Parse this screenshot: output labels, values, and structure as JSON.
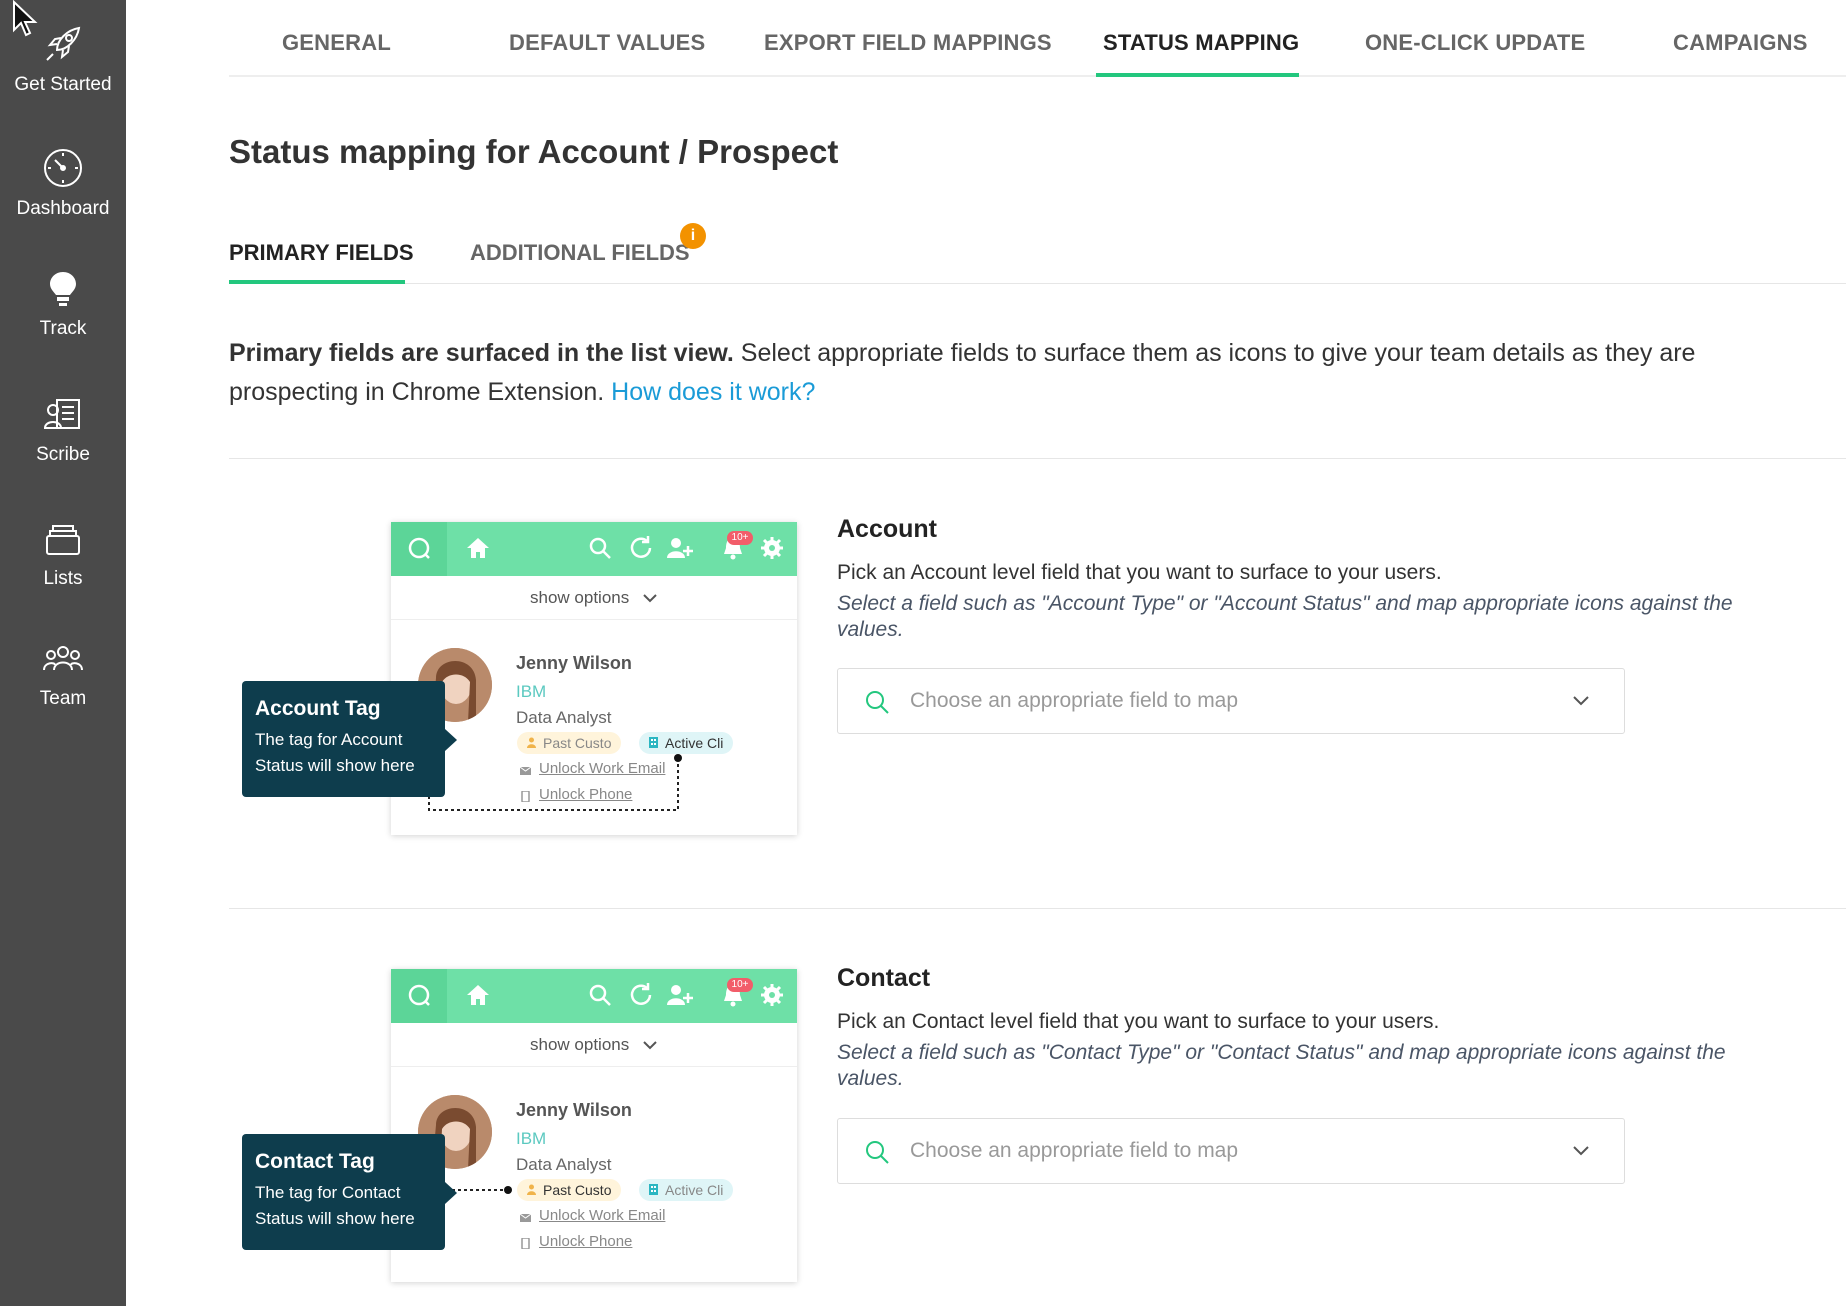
{
  "sidebar": {
    "items": [
      {
        "label": "Get Started",
        "icon": "rocket-icon"
      },
      {
        "label": "Dashboard",
        "icon": "clock-icon"
      },
      {
        "label": "Track",
        "icon": "lightbulb-icon"
      },
      {
        "label": "Scribe",
        "icon": "scribe-icon"
      },
      {
        "label": "Lists",
        "icon": "stack-icon"
      },
      {
        "label": "Team",
        "icon": "team-icon"
      }
    ]
  },
  "tabs": [
    {
      "label": "GENERAL"
    },
    {
      "label": "DEFAULT VALUES"
    },
    {
      "label": "EXPORT FIELD MAPPINGS"
    },
    {
      "label": "STATUS MAPPING",
      "active": true
    },
    {
      "label": "ONE-CLICK UPDATE"
    },
    {
      "label": "CAMPAIGNS"
    }
  ],
  "page": {
    "title": "Status mapping for Account / Prospect"
  },
  "subtabs": {
    "primary": "PRIMARY FIELDS",
    "additional": "ADDITIONAL FIELDS",
    "info_badge": "i"
  },
  "intro": {
    "bold": "Primary fields are surfaced in the list view.",
    "text": " Select appropriate fields to surface them as icons to give your team details as they are prospecting in Chrome Extension. ",
    "link": "How does it work?"
  },
  "mock": {
    "notification_count": "10+",
    "show_options": "show options",
    "name": "Jenny Wilson",
    "company": "IBM",
    "title": "Data Analyst",
    "chip_past": "Past Custo",
    "chip_active": "Active Cli",
    "unlock_email": "Unlock Work Email",
    "unlock_phone": "Unlock Phone"
  },
  "account": {
    "tag_title": "Account Tag",
    "tag_desc": "The tag for Account Status will show here",
    "heading": "Account",
    "desc": "Pick an Account level field that you want to surface to your users.",
    "hint": "Select a field such as \"Account Type\" or \"Account Status\" and map appropriate icons against the values.",
    "placeholder": "Choose an appropriate field to map"
  },
  "contact": {
    "tag_title": "Contact Tag",
    "tag_desc": "The tag for Contact Status will show here",
    "heading": "Contact",
    "desc": "Pick an Contact level field that you want to surface to your users.",
    "hint": "Select a field such as \"Contact Type\" or \"Contact Status\" and map appropriate icons against the values.",
    "placeholder": "Choose an appropriate field to map"
  },
  "colors": {
    "accent": "#23c77e",
    "sidebar": "#4a4a4a",
    "link": "#1a9bd7",
    "tooltip": "#0e3d4d",
    "badge": "#f39200"
  }
}
